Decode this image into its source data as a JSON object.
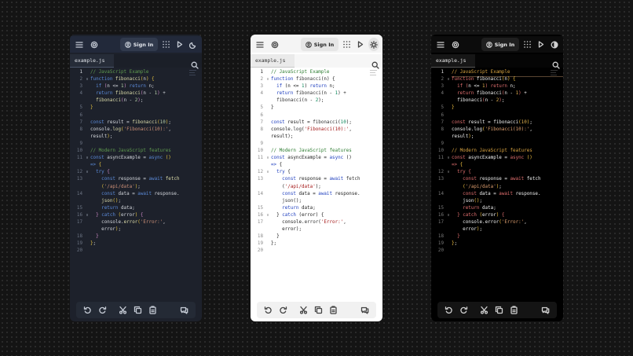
{
  "editor": {
    "file_tab": "example.js",
    "signin_label": "Sign In",
    "code_lines": [
      {
        "n": "1",
        "fold": "",
        "toks": [
          {
            "t": "// JavaScript Example",
            "c": "com"
          }
        ]
      },
      {
        "n": "2",
        "fold": "v",
        "toks": [
          {
            "t": "function ",
            "c": "kw"
          },
          {
            "t": "fibonacci",
            "c": "fn"
          },
          {
            "t": "(",
            "c": "br"
          },
          {
            "t": "n",
            "c": "var"
          },
          {
            "t": ")",
            "c": "br"
          },
          {
            "t": " {",
            "c": "br"
          }
        ]
      },
      {
        "n": "3",
        "fold": "",
        "toks": [
          {
            "t": "  if ",
            "c": "kw"
          },
          {
            "t": "(",
            "c": "br2"
          },
          {
            "t": "n <= ",
            "c": "var"
          },
          {
            "t": "1",
            "c": "num"
          },
          {
            "t": ")",
            "c": "br2"
          },
          {
            "t": " return ",
            "c": "kw"
          },
          {
            "t": "n;",
            "c": "var"
          }
        ]
      },
      {
        "n": "4",
        "fold": "",
        "toks": [
          {
            "t": "  return ",
            "c": "kw"
          },
          {
            "t": "fibonacci",
            "c": "fn"
          },
          {
            "t": "(",
            "c": "br2"
          },
          {
            "t": "n - ",
            "c": "var"
          },
          {
            "t": "1",
            "c": "num"
          },
          {
            "t": ")",
            "c": "br2"
          },
          {
            "t": " +",
            "c": "op"
          }
        ]
      },
      {
        "n": "",
        "fold": "",
        "toks": [
          {
            "t": "  fibonacci",
            "c": "fn"
          },
          {
            "t": "(",
            "c": "br2"
          },
          {
            "t": "n - ",
            "c": "var"
          },
          {
            "t": "2",
            "c": "num"
          },
          {
            "t": ")",
            "c": "br2"
          },
          {
            "t": ";",
            "c": "op"
          }
        ]
      },
      {
        "n": "5",
        "fold": "",
        "toks": [
          {
            "t": "}",
            "c": "br"
          }
        ]
      },
      {
        "n": "6",
        "fold": "",
        "toks": []
      },
      {
        "n": "7",
        "fold": "",
        "toks": [
          {
            "t": "const ",
            "c": "kw"
          },
          {
            "t": "result = ",
            "c": "var"
          },
          {
            "t": "fibonacci",
            "c": "fn"
          },
          {
            "t": "(",
            "c": "br"
          },
          {
            "t": "10",
            "c": "num"
          },
          {
            "t": ")",
            "c": "br"
          },
          {
            "t": ";",
            "c": "op"
          }
        ]
      },
      {
        "n": "8",
        "fold": "",
        "toks": [
          {
            "t": "console.",
            "c": "var"
          },
          {
            "t": "log",
            "c": "fn"
          },
          {
            "t": "(",
            "c": "br"
          },
          {
            "t": "'Fibonacci(10):'",
            "c": "str"
          },
          {
            "t": ",",
            "c": "op"
          }
        ]
      },
      {
        "n": "",
        "fold": "",
        "toks": [
          {
            "t": "result",
            "c": "var"
          },
          {
            "t": ")",
            "c": "br"
          },
          {
            "t": ";",
            "c": "op"
          }
        ]
      },
      {
        "n": "9",
        "fold": "",
        "toks": []
      },
      {
        "n": "10",
        "fold": "",
        "toks": [
          {
            "t": "// Modern JavaScript features",
            "c": "com"
          }
        ]
      },
      {
        "n": "11",
        "fold": "v",
        "toks": [
          {
            "t": "const ",
            "c": "kw"
          },
          {
            "t": "asyncExample = ",
            "c": "var"
          },
          {
            "t": "async ",
            "c": "kw"
          },
          {
            "t": "()",
            "c": "br"
          }
        ]
      },
      {
        "n": "",
        "fold": "",
        "toks": [
          {
            "t": "=> ",
            "c": "kw"
          },
          {
            "t": "{",
            "c": "br"
          }
        ]
      },
      {
        "n": "12",
        "fold": "v",
        "toks": [
          {
            "t": "  try ",
            "c": "kw"
          },
          {
            "t": "{",
            "c": "br2"
          }
        ]
      },
      {
        "n": "13",
        "fold": "",
        "toks": [
          {
            "t": "    const ",
            "c": "kw"
          },
          {
            "t": "response = ",
            "c": "var"
          },
          {
            "t": "await ",
            "c": "kw"
          },
          {
            "t": "fetch",
            "c": "fn"
          }
        ]
      },
      {
        "n": "",
        "fold": "",
        "toks": [
          {
            "t": "    (",
            "c": "br"
          },
          {
            "t": "'/api/data'",
            "c": "str"
          },
          {
            "t": ")",
            "c": "br"
          },
          {
            "t": ";",
            "c": "op"
          }
        ]
      },
      {
        "n": "14",
        "fold": "",
        "toks": [
          {
            "t": "    const ",
            "c": "kw"
          },
          {
            "t": "data = ",
            "c": "var"
          },
          {
            "t": "await ",
            "c": "kw"
          },
          {
            "t": "response.",
            "c": "var"
          }
        ]
      },
      {
        "n": "",
        "fold": "",
        "toks": [
          {
            "t": "    json",
            "c": "fn"
          },
          {
            "t": "()",
            "c": "br"
          },
          {
            "t": ";",
            "c": "op"
          }
        ]
      },
      {
        "n": "15",
        "fold": "",
        "toks": [
          {
            "t": "    return ",
            "c": "kw"
          },
          {
            "t": "data;",
            "c": "var"
          }
        ]
      },
      {
        "n": "16",
        "fold": "v",
        "toks": [
          {
            "t": "  } ",
            "c": "br2"
          },
          {
            "t": "catch ",
            "c": "kw"
          },
          {
            "t": "(",
            "c": "br"
          },
          {
            "t": "error",
            "c": "var"
          },
          {
            "t": ")",
            "c": "br"
          },
          {
            "t": " {",
            "c": "br2"
          }
        ]
      },
      {
        "n": "17",
        "fold": "",
        "toks": [
          {
            "t": "    console.",
            "c": "var"
          },
          {
            "t": "error",
            "c": "fn"
          },
          {
            "t": "(",
            "c": "br"
          },
          {
            "t": "'Error:'",
            "c": "str"
          },
          {
            "t": ",",
            "c": "op"
          }
        ]
      },
      {
        "n": "",
        "fold": "",
        "toks": [
          {
            "t": "    error",
            "c": "var"
          },
          {
            "t": ")",
            "c": "br"
          },
          {
            "t": ";",
            "c": "op"
          }
        ]
      },
      {
        "n": "18",
        "fold": "",
        "toks": [
          {
            "t": "  }",
            "c": "br2"
          }
        ]
      },
      {
        "n": "19",
        "fold": "",
        "toks": [
          {
            "t": "}",
            "c": "br"
          },
          {
            "t": ";",
            "c": "op"
          }
        ]
      },
      {
        "n": "20",
        "fold": "",
        "toks": []
      }
    ]
  },
  "themes": [
    {
      "name": "dark-blue",
      "accent": "#5b8ad8",
      "background": "#1d212b"
    },
    {
      "name": "light",
      "accent": "#1f3fbf",
      "background": "#ffffff"
    },
    {
      "name": "black",
      "accent": "#e06f6f",
      "background": "#000000"
    }
  ],
  "icons": [
    "menu-icon",
    "gear-icon",
    "user-icon",
    "apps-grid-icon",
    "run-icon",
    "theme-toggle-icon",
    "search-icon",
    "undo-icon",
    "redo-icon",
    "cut-icon",
    "copy-icon",
    "paste-icon",
    "chat-icon"
  ]
}
